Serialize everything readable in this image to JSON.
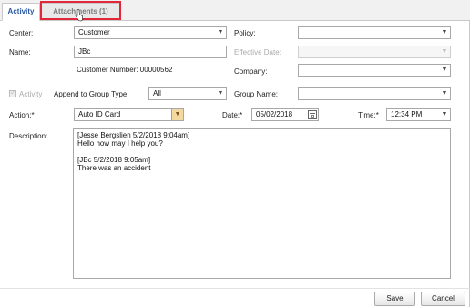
{
  "tabs": [
    {
      "label": "Activity"
    },
    {
      "label": "Attachments (1)"
    }
  ],
  "form": {
    "center": {
      "label": "Center:",
      "value": "Customer"
    },
    "name": {
      "label": "Name:",
      "value": "JBc"
    },
    "customer_number": "Customer Number: 00000562",
    "policy": {
      "label": "Policy:",
      "value": ""
    },
    "effective_date": {
      "label": "Effective Date:",
      "value": ""
    },
    "company": {
      "label": "Company:",
      "value": ""
    },
    "activity_check": {
      "label": "Activity",
      "checked": true,
      "disabled": true
    },
    "append_group_type": {
      "label": "Append to Group Type:",
      "value": "All"
    },
    "group_name": {
      "label": "Group Name:",
      "value": ""
    },
    "action": {
      "label": "Action:*",
      "value": "Auto ID Card"
    },
    "date": {
      "label": "Date:*",
      "value": "05/02/2018"
    },
    "time": {
      "label": "Time:*",
      "value": "12:34 PM"
    },
    "description": {
      "label": "Description:",
      "lines": [
        "[Jesse Bergslien 5/2/2018 9:04am]",
        "Hello how may I help you?",
        "",
        "[JBc 5/2/2018 9:05am]",
        "There was an accident"
      ]
    }
  },
  "buttons": {
    "save": "Save",
    "cancel": "Cancel"
  },
  "icons": {
    "dropdown": "chevron-down-icon",
    "calendar": "calendar-icon",
    "cursor": "hand-pointer-icon"
  },
  "colors": {
    "highlight": "#e0283a",
    "active_tab_text": "#2b5aa3",
    "dropdown_accent": "#f3d9a0"
  }
}
